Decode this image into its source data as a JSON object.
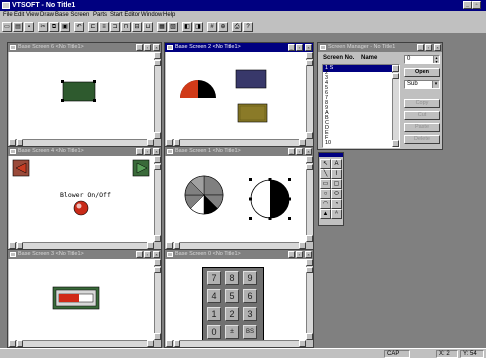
{
  "app": {
    "title": "VTSOFT - No Title1"
  },
  "menu": [
    "File",
    "Edit",
    "View",
    "Draw",
    "Base Screen",
    "Parts",
    "Start Editor",
    "Window",
    "Help"
  ],
  "toolbar_icons": [
    "new-icon",
    "open-icon",
    "save-icon",
    "cut-icon",
    "copy-icon",
    "paste-icon",
    "undo-icon",
    "align-left-icon",
    "align-center-icon",
    "align-right-icon",
    "align-top-icon",
    "align-middle-icon",
    "align-bottom-icon",
    "group-icon",
    "ungroup-icon",
    "front-icon",
    "back-icon",
    "grid-icon",
    "zoom-icon",
    "print-icon",
    "help-icon"
  ],
  "windows": {
    "bs6": {
      "title": "Base Screen 6 <No Title1>"
    },
    "bs2": {
      "title": "Base Screen 2 <No Title1>"
    },
    "bs4": {
      "title": "Base Screen 4 <No Title1>",
      "label": "Blower On/Off"
    },
    "bs1": {
      "title": "Base Screen 1 <No Title1>"
    },
    "bs3": {
      "title": "Base Screen 3 <No Title1>"
    },
    "bs0": {
      "title": "Base Screen 0 <No Title1>",
      "keys": [
        "7",
        "8",
        "9",
        "4",
        "5",
        "6",
        "1",
        "2",
        "3",
        "0",
        "±",
        "BS"
      ]
    }
  },
  "screen_manager": {
    "title": "Screen Manager - No Title1",
    "col_screen_no": "Screen No.",
    "col_name": "Name",
    "items": [
      "1 S",
      "2",
      "3",
      "4",
      "5",
      "6",
      "7",
      "8",
      "9",
      "A",
      "B",
      "C",
      "D",
      "E",
      "F",
      "10"
    ],
    "number_value": "0",
    "open_label": "Open",
    "type_value": "Sub",
    "copy_label": "Copy",
    "cut_label": "Cut",
    "paste_label": "Paste",
    "delete_label": "Delete"
  },
  "status": {
    "mode": "CAP",
    "x": "X: 2",
    "y": "Y: 54"
  },
  "colors": {
    "title_active": "#000080",
    "face": "#c0c0c0",
    "desktop": "#808080"
  }
}
